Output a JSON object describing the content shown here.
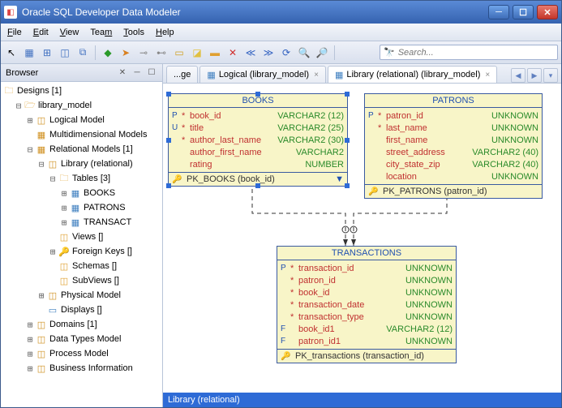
{
  "app": {
    "title": "Oracle SQL Developer Data Modeler"
  },
  "menu": {
    "file": "File",
    "edit": "Edit",
    "view": "View",
    "team": "Team",
    "tools": "Tools",
    "help": "Help"
  },
  "search": {
    "placeholder": "Search..."
  },
  "browser": {
    "title": "Browser",
    "root": "Designs [1]",
    "nodes": {
      "library_model": "library_model",
      "logical": "Logical Model",
      "multi": "Multidimensional Models",
      "relational": "Relational Models [1]",
      "library_rel": "Library (relational)",
      "tables": "Tables [3]",
      "t_books": "BOOKS",
      "t_patrons": "PATRONS",
      "t_trans": "TRANSACT",
      "views": "Views []",
      "fkeys": "Foreign Keys []",
      "schemas": "Schemas []",
      "subviews": "SubViews []",
      "physical": "Physical Model",
      "displays": "Displays []",
      "domains": "Domains [1]",
      "datatypes": "Data Types Model",
      "process": "Process Model",
      "business": "Business Information"
    }
  },
  "tabs": {
    "t1": "...ge",
    "t2": "Logical (library_model)",
    "t3": "Library (relational) (library_model)"
  },
  "entities": {
    "books": {
      "title": "BOOKS",
      "cols": [
        {
          "flag": "P",
          "ast": "*",
          "name": "book_id",
          "type": "VARCHAR2 (12)"
        },
        {
          "flag": "U",
          "ast": "*",
          "name": "title",
          "type": "VARCHAR2 (25)"
        },
        {
          "flag": "",
          "ast": "*",
          "name": "author_last_name",
          "type": "VARCHAR2 (30)"
        },
        {
          "flag": "",
          "ast": "",
          "name": "author_first_name",
          "type": "VARCHAR2"
        },
        {
          "flag": "",
          "ast": "",
          "name": "rating",
          "type": "NUMBER"
        }
      ],
      "key": "PK_BOOKS (book_id)"
    },
    "patrons": {
      "title": "PATRONS",
      "cols": [
        {
          "flag": "P",
          "ast": "*",
          "name": "patron_id",
          "type": "UNKNOWN"
        },
        {
          "flag": "",
          "ast": "*",
          "name": "last_name",
          "type": "UNKNOWN"
        },
        {
          "flag": "",
          "ast": "",
          "name": "first_name",
          "type": "UNKNOWN"
        },
        {
          "flag": "",
          "ast": "",
          "name": "street_address",
          "type": "VARCHAR2 (40)"
        },
        {
          "flag": "",
          "ast": "",
          "name": "city_state_zip",
          "type": "VARCHAR2 (40)"
        },
        {
          "flag": "",
          "ast": "",
          "name": "location",
          "type": "UNKNOWN"
        }
      ],
      "key": "PK_PATRONS (patron_id)"
    },
    "trans": {
      "title": "TRANSACTIONS",
      "cols": [
        {
          "flag": "P",
          "ast": "*",
          "name": "transaction_id",
          "type": "UNKNOWN"
        },
        {
          "flag": "",
          "ast": "*",
          "name": "patron_id",
          "type": "UNKNOWN"
        },
        {
          "flag": "",
          "ast": "*",
          "name": "book_id",
          "type": "UNKNOWN"
        },
        {
          "flag": "",
          "ast": "*",
          "name": "transaction_date",
          "type": "UNKNOWN"
        },
        {
          "flag": "",
          "ast": "*",
          "name": "transaction_type",
          "type": "UNKNOWN"
        },
        {
          "flag": "F",
          "ast": "",
          "name": "book_id1",
          "type": "VARCHAR2 (12)"
        },
        {
          "flag": "F",
          "ast": "",
          "name": "patron_id1",
          "type": "UNKNOWN"
        }
      ],
      "key": "PK_transactions (transaction_id)"
    }
  },
  "status": "Library (relational)"
}
